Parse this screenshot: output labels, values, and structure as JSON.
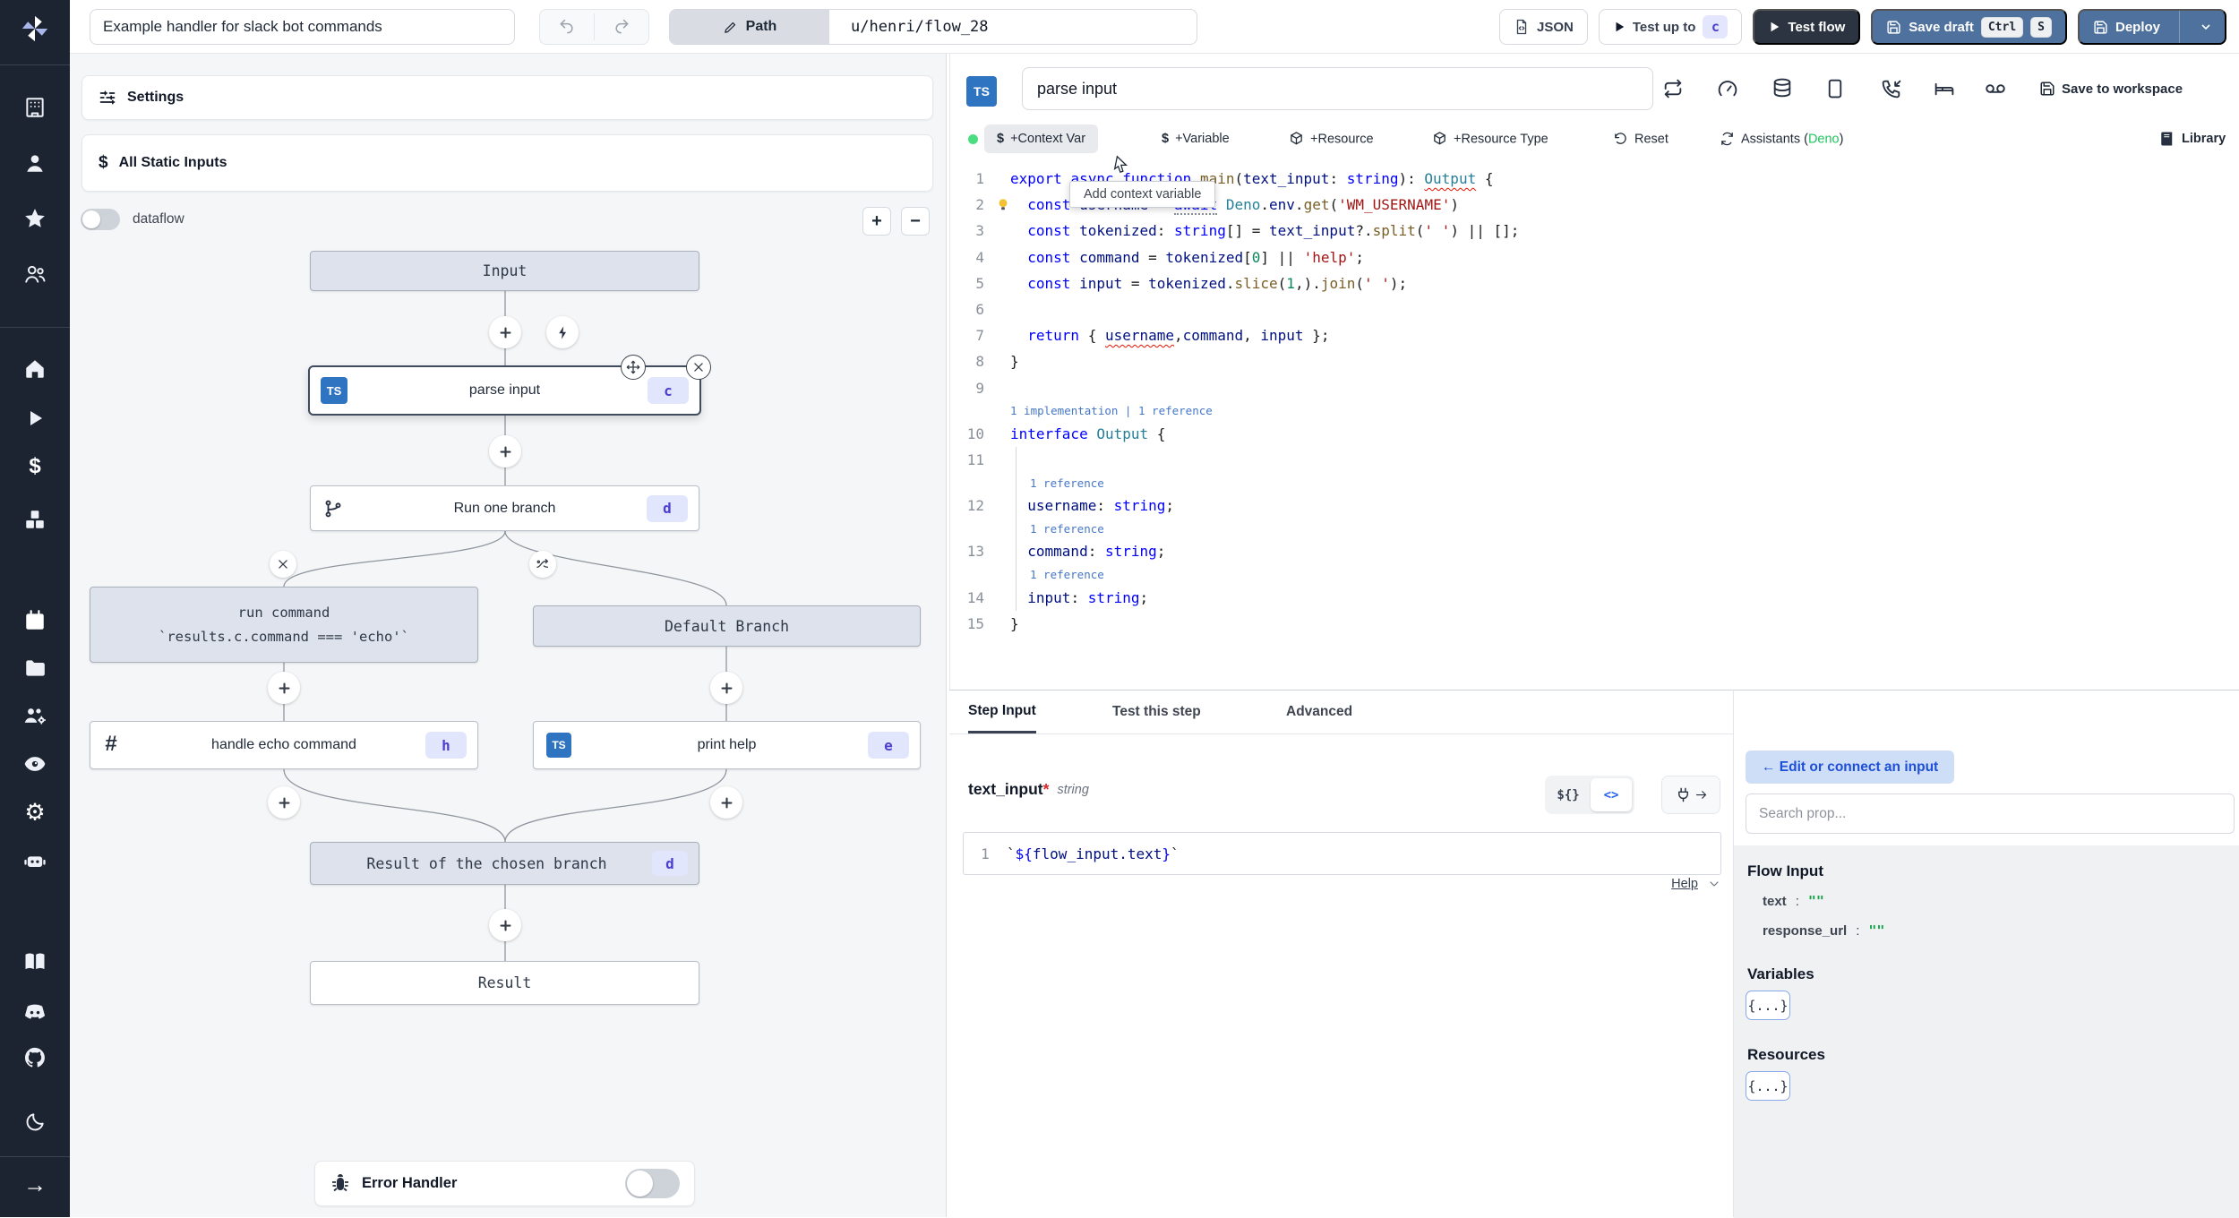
{
  "topbar": {
    "title": "Example handler for slack bot commands",
    "path_label": "Path",
    "path_value": "u/henri/flow_28",
    "json_btn": "JSON",
    "test_up_to": "Test up to",
    "test_up_to_badge": "c",
    "test_flow": "Test flow",
    "save_draft": "Save draft",
    "kbd_ctrl": "Ctrl",
    "kbd_s": "S",
    "deploy": "Deploy"
  },
  "flow_panel": {
    "settings": "Settings",
    "all_static_inputs": "All Static Inputs",
    "dataflow_label": "dataflow",
    "zoom_in": "+",
    "zoom_out": "−",
    "nodes": {
      "input": "Input",
      "parse_input": {
        "label": "parse input",
        "badge": "c",
        "lang": "TS"
      },
      "run_one_branch": {
        "label": "Run one branch",
        "badge": "d"
      },
      "run_command": {
        "line1": "run command",
        "line2": "`results.c.command === 'echo'`"
      },
      "default_branch": "Default Branch",
      "handle_echo": {
        "label": "handle echo command",
        "badge": "h"
      },
      "print_help": {
        "label": "print help",
        "badge": "e",
        "lang": "TS"
      },
      "result_chosen": {
        "label": "Result of the chosen branch",
        "badge": "d"
      },
      "result": "Result",
      "error_handler": "Error Handler"
    }
  },
  "editor": {
    "lang_badge": "TS",
    "step_name": "parse input",
    "toolbar": {
      "context_var": "+Context Var",
      "variable": "+Variable",
      "resource": "+Resource",
      "resource_type": "+Resource Type",
      "reset": "Reset",
      "assistants": "Assistants (",
      "assistants_lang": "Deno",
      "assistants_close": ")",
      "library": "Library",
      "save_to_workspace": "Save to workspace"
    },
    "tooltip": "Add context variable",
    "code_rows": [
      {
        "no": "1",
        "tokens": [
          [
            "export ",
            "k"
          ],
          [
            "async ",
            "k"
          ],
          [
            "function ",
            "k"
          ],
          [
            "main",
            "f"
          ],
          [
            "(",
            "p"
          ],
          [
            "text_input",
            "v"
          ],
          [
            ": ",
            "p"
          ],
          [
            "string",
            "k"
          ],
          [
            "): ",
            "p"
          ],
          [
            "Output",
            "t sq"
          ],
          [
            " {",
            "p"
          ]
        ]
      },
      {
        "no": "2",
        "bulb": true,
        "tokens": [
          [
            "  ",
            "p"
          ],
          [
            "const ",
            "k"
          ],
          [
            "username",
            "v"
          ],
          [
            " = ",
            "p"
          ],
          [
            "await",
            "k dt"
          ],
          [
            " ",
            "p"
          ],
          [
            "Deno",
            "t"
          ],
          [
            ".",
            "p"
          ],
          [
            "env",
            "v"
          ],
          [
            ".",
            "p"
          ],
          [
            "get",
            "f"
          ],
          [
            "(",
            "p"
          ],
          [
            "'WM_USERNAME'",
            "s"
          ],
          [
            ")",
            "p"
          ]
        ]
      },
      {
        "no": "3",
        "tokens": [
          [
            "  ",
            "p"
          ],
          [
            "const ",
            "k"
          ],
          [
            "tokenized",
            "v"
          ],
          [
            ": ",
            "p"
          ],
          [
            "string",
            "k"
          ],
          [
            "[] = ",
            "p"
          ],
          [
            "text_input",
            "v"
          ],
          [
            "?.",
            "p"
          ],
          [
            "split",
            "f"
          ],
          [
            "(",
            "p"
          ],
          [
            "' '",
            "s"
          ],
          [
            ") || [];",
            "p"
          ]
        ]
      },
      {
        "no": "4",
        "tokens": [
          [
            "  ",
            "p"
          ],
          [
            "const ",
            "k"
          ],
          [
            "command",
            "v"
          ],
          [
            " = ",
            "p"
          ],
          [
            "tokenized",
            "v"
          ],
          [
            "[",
            "p"
          ],
          [
            "0",
            "n"
          ],
          [
            "] || ",
            "p"
          ],
          [
            "'help'",
            "s"
          ],
          [
            ";",
            "p"
          ]
        ]
      },
      {
        "no": "5",
        "tokens": [
          [
            "  ",
            "p"
          ],
          [
            "const ",
            "k"
          ],
          [
            "input",
            "v"
          ],
          [
            " = ",
            "p"
          ],
          [
            "tokenized",
            "v"
          ],
          [
            ".",
            "p"
          ],
          [
            "slice",
            "f"
          ],
          [
            "(",
            "p"
          ],
          [
            "1",
            "n"
          ],
          [
            ",).",
            "p"
          ],
          [
            "join",
            "f"
          ],
          [
            "(",
            "p"
          ],
          [
            "' '",
            "s"
          ],
          [
            ");",
            "p"
          ]
        ]
      },
      {
        "no": "6",
        "tokens": []
      },
      {
        "no": "7",
        "tokens": [
          [
            "  ",
            "p"
          ],
          [
            "return",
            "k"
          ],
          [
            " { ",
            "p"
          ],
          [
            "username",
            "v sq"
          ],
          [
            ",",
            "p"
          ],
          [
            "command",
            "v"
          ],
          [
            ", ",
            "p"
          ],
          [
            "input",
            "v"
          ],
          [
            " };",
            "p"
          ]
        ]
      },
      {
        "no": "8",
        "tokens": [
          [
            "}",
            "p"
          ]
        ]
      },
      {
        "no": "9",
        "tokens": []
      },
      {
        "lens": "1 implementation | 1 reference",
        "indent": 0
      },
      {
        "no": "10",
        "tokens": [
          [
            "interface ",
            "k"
          ],
          [
            "Output",
            "t"
          ],
          [
            " {",
            "p"
          ]
        ]
      },
      {
        "no": "11",
        "tokens": []
      },
      {
        "lens": "1 reference",
        "indent": 22
      },
      {
        "no": "12",
        "tokens": [
          [
            "  ",
            "p"
          ],
          [
            "username",
            "v"
          ],
          [
            ": ",
            "p"
          ],
          [
            "string",
            "k"
          ],
          [
            ";",
            "p"
          ]
        ]
      },
      {
        "lens": "1 reference",
        "indent": 22
      },
      {
        "no": "13",
        "tokens": [
          [
            "  ",
            "p"
          ],
          [
            "command",
            "v"
          ],
          [
            ": ",
            "p"
          ],
          [
            "string",
            "k"
          ],
          [
            ";",
            "p"
          ]
        ]
      },
      {
        "lens": "1 reference",
        "indent": 22
      },
      {
        "no": "14",
        "tokens": [
          [
            "  ",
            "p"
          ],
          [
            "input",
            "v"
          ],
          [
            ": ",
            "p"
          ],
          [
            "string",
            "k"
          ],
          [
            ";",
            "p"
          ]
        ]
      },
      {
        "no": "15",
        "tokens": [
          [
            "}",
            "p"
          ]
        ]
      }
    ]
  },
  "step_panel": {
    "tabs": [
      "Step Input",
      "Test this step",
      "Advanced"
    ],
    "field_name": "text_input",
    "required_mark": "*",
    "field_type": "string",
    "toggle_json": "${}",
    "toggle_code": "<>",
    "expr_line_no": "1",
    "expr_tokens": [
      [
        "`",
        "p"
      ],
      [
        "${",
        "k"
      ],
      [
        "flow_input.text",
        "v"
      ],
      [
        "}",
        "k"
      ],
      [
        "`",
        "p"
      ]
    ],
    "help": "Help"
  },
  "connect_panel": {
    "edit_btn": "← Edit or connect an input",
    "search_placeholder": "Search prop...",
    "flow_input_title": "Flow Input",
    "props": [
      {
        "key": "text",
        "value": "\"\""
      },
      {
        "key": "response_url",
        "value": "\"\""
      }
    ],
    "variables_title": "Variables",
    "variables_chip": "{...}",
    "resources_title": "Resources",
    "resources_chip": "{...}"
  }
}
